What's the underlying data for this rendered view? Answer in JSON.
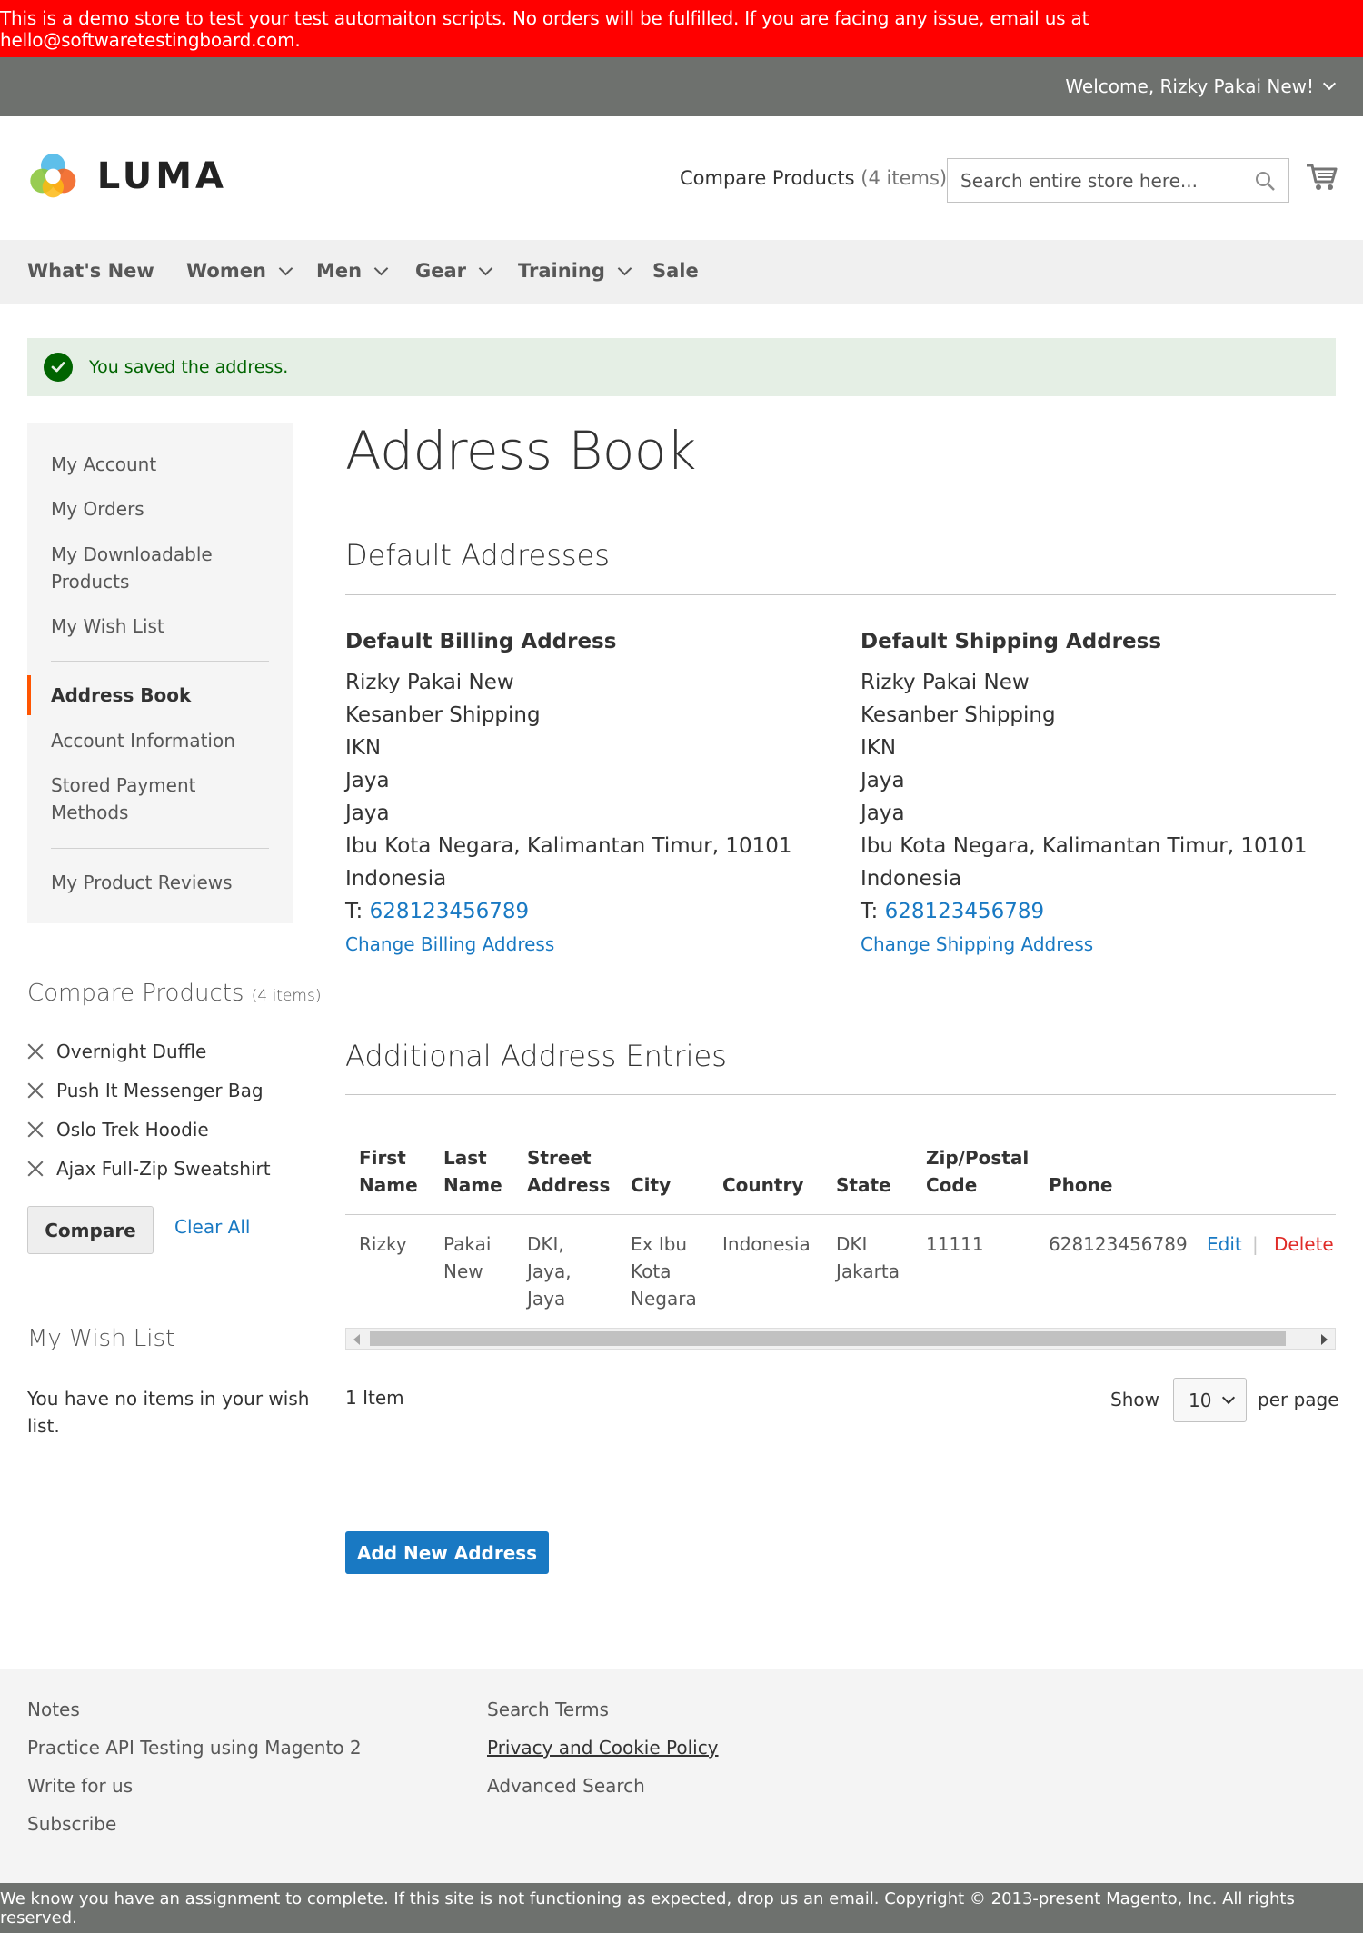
{
  "demo_banner": "This is a demo store to test your test automaiton scripts. No orders will be fulfilled. If you are facing any issue, email us at hello@softwaretestingboard.com.",
  "header": {
    "welcome": "Welcome, Rizky Pakai New!",
    "logo_text": "LUMA",
    "compare_label": "Compare Products",
    "compare_count": "(4 items)",
    "search_placeholder": "Search entire store here...",
    "icons": [
      "chevron-down-icon",
      "search-icon",
      "cart-icon"
    ]
  },
  "nav": {
    "items": [
      {
        "label": "What's New"
      },
      {
        "label": "Women"
      },
      {
        "label": "Men"
      },
      {
        "label": "Gear"
      },
      {
        "label": "Training"
      },
      {
        "label": "Sale"
      }
    ]
  },
  "message": "You saved the address.",
  "sidebar": {
    "items": [
      {
        "label": "My Account"
      },
      {
        "label": "My Orders"
      },
      {
        "label": "My Downloadable Products"
      },
      {
        "label": "My Wish List"
      },
      {
        "label": "Address Book"
      },
      {
        "label": "Account Information"
      },
      {
        "label": "Stored Payment Methods"
      },
      {
        "label": "My Product Reviews"
      }
    ],
    "compare_title": "Compare Products",
    "compare_count": "(4 items)",
    "compare_items": [
      {
        "label": "Overnight Duffle"
      },
      {
        "label": "Push It Messenger Bag"
      },
      {
        "label": "Oslo Trek Hoodie"
      },
      {
        "label": "Ajax Full-Zip Sweatshirt"
      }
    ],
    "compare_button": "Compare",
    "clear_all": "Clear All",
    "wish_title": "My Wish List",
    "wish_empty": "You have no items in your wish list."
  },
  "main": {
    "title": "Address Book",
    "default_title": "Default Addresses",
    "billing": {
      "heading": "Default Billing Address",
      "lines": [
        "Rizky Pakai New",
        "Kesanber Shipping",
        "IKN",
        "Jaya",
        "Jaya",
        "Ibu Kota Negara, Kalimantan Timur, 10101",
        "Indonesia"
      ],
      "phone_prefix": "T:",
      "phone": "628123456789",
      "change": "Change Billing Address"
    },
    "shipping": {
      "heading": "Default Shipping Address",
      "lines": [
        "Rizky Pakai New",
        "Kesanber Shipping",
        "IKN",
        "Jaya",
        "Jaya",
        "Ibu Kota Negara, Kalimantan Timur, 10101",
        "Indonesia"
      ],
      "phone_prefix": "T:",
      "phone": "628123456789",
      "change": "Change Shipping Address"
    },
    "additional_title": "Additional Address Entries",
    "table": {
      "headers": [
        [
          "First",
          "Name"
        ],
        [
          "Last",
          "Name"
        ],
        [
          "Street",
          "Address"
        ],
        [
          "City"
        ],
        [
          "Country"
        ],
        [
          "State"
        ],
        [
          "Zip/Postal",
          "Code"
        ],
        [
          "Phone"
        ]
      ],
      "row": {
        "first": [
          "Rizky"
        ],
        "last": [
          "Pakai",
          "New"
        ],
        "street": [
          "DKI,",
          "Jaya,",
          "Jaya"
        ],
        "city": [
          "Ex Ibu",
          "Kota",
          "Negara"
        ],
        "country": [
          "Indonesia"
        ],
        "state": [
          "DKI",
          "Jakarta"
        ],
        "zip": [
          "11111"
        ],
        "phone": [
          "628123456789"
        ],
        "edit": "Edit",
        "sep": "|",
        "delete": "Delete"
      }
    },
    "items_count": "1 Item",
    "show_label": "Show",
    "limiter_value": "10",
    "per_page": "per page",
    "add_button": "Add New Address"
  },
  "footer": {
    "col1": [
      "Notes",
      "Practice API Testing using Magento 2",
      "Write for us",
      "Subscribe"
    ],
    "col2": [
      "Search Terms",
      "Privacy and Cookie Policy",
      "Advanced Search"
    ],
    "copyright": "We know you have an assignment to complete. If this site is not functioning as expected, drop us an email. Copyright © 2013-present Magento, Inc. All rights reserved."
  },
  "colors": {
    "banner": "#ff0000",
    "header_bar": "#6e716e",
    "link": "#1979c3",
    "success_bg": "#e5efe5",
    "success_text": "#006400",
    "active_marker": "#ff5501",
    "delete": "#e02b27"
  }
}
